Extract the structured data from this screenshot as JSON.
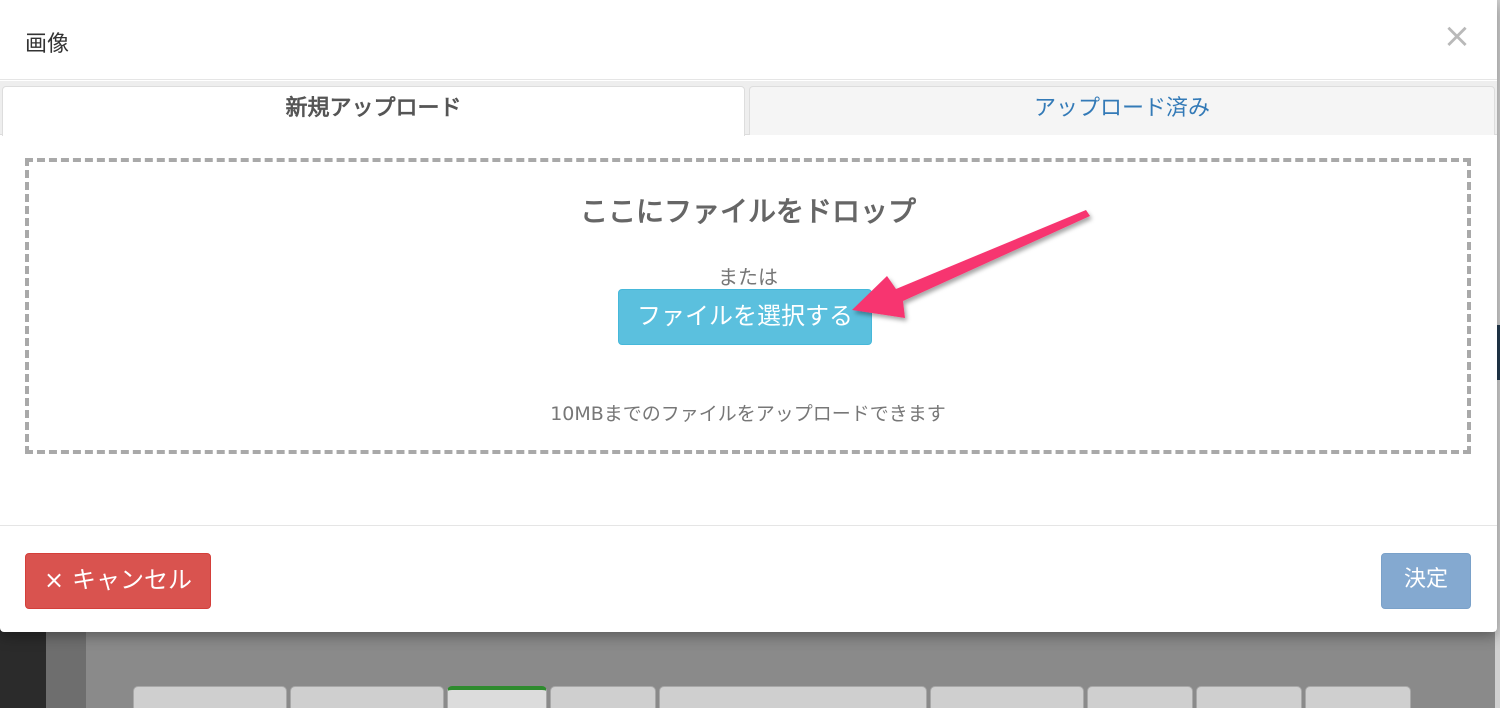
{
  "modal": {
    "title": "画像",
    "close_icon": "×"
  },
  "tabs": [
    {
      "label": "新規アップロード",
      "active": true
    },
    {
      "label": "アップロード済み",
      "active": false
    }
  ],
  "drop_zone": {
    "title": "ここにファイルをドロップ",
    "or_text": "または",
    "select_button": "ファイルを選択する",
    "size_note": "10MBまでのファイルをアップロードできます"
  },
  "footer": {
    "cancel_icon": "×",
    "cancel_label": "キャンセル",
    "ok_label": "決定"
  },
  "colors": {
    "select_button": "#5bc0de",
    "cancel_button": "#d9534f",
    "ok_button": "#84a9d0",
    "arrow": "#f7346f",
    "link_tab": "#337ab7"
  }
}
